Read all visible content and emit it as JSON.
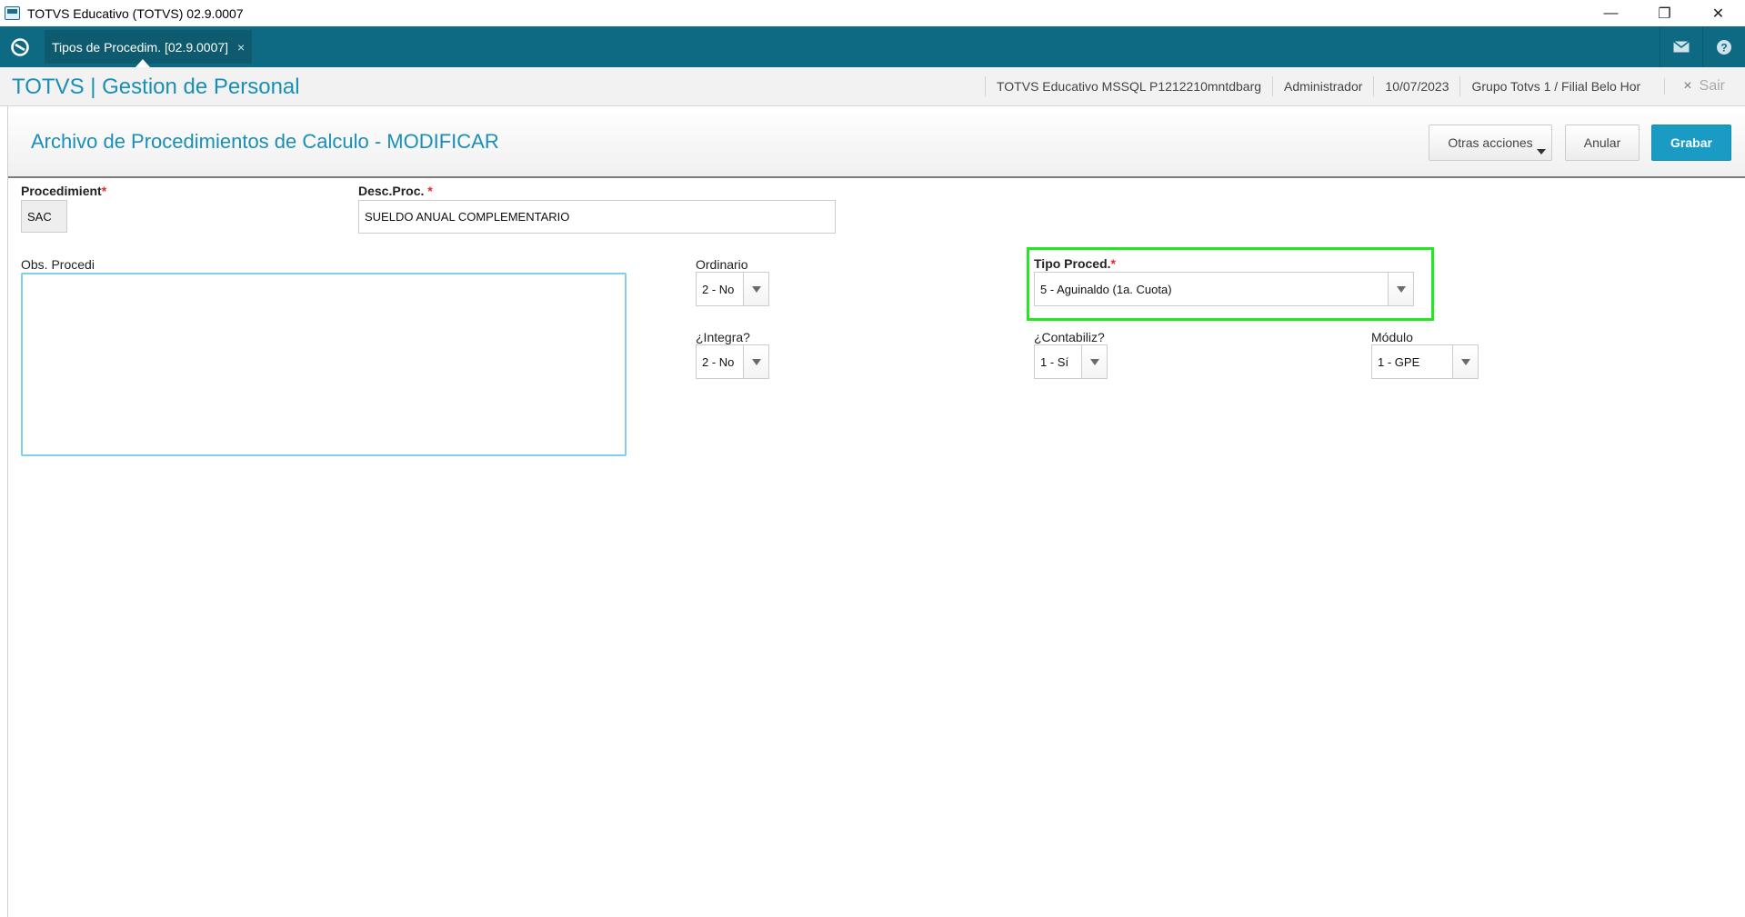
{
  "window": {
    "title": "TOTVS Educativo (TOTVS) 02.9.0007",
    "controls": {
      "minimize": "—",
      "restore": "❐",
      "close": "✕"
    }
  },
  "tabbar": {
    "tab_label": "Tipos de Procedim. [02.9.0007]",
    "tab_close": "×",
    "icons": [
      "home-icon",
      "mail-icon",
      "help-icon"
    ],
    "help_label": "?"
  },
  "header": {
    "app_title": "TOTVS | Gestion de Personal",
    "environment": "TOTVS Educativo MSSQL P1212210mntdbarg",
    "user": "Administrador",
    "date": "10/07/2023",
    "branch": "Grupo Totvs 1 / Filial Belo Hor",
    "exit_label": "Sair",
    "exit_icon": "×"
  },
  "form": {
    "title": "Archivo de Procedimientos de Calculo - MODIFICAR",
    "buttons": {
      "more": "Otras acciones",
      "cancel": "Anular",
      "save": "Grabar"
    },
    "fields": {
      "procedimiento": {
        "label": "Procedimient",
        "required": "*",
        "value": "SAC"
      },
      "desc_proc": {
        "label": "Desc.Proc.",
        "required": "*",
        "value": "SUELDO ANUAL COMPLEMENTARIO"
      },
      "obs": {
        "label": "Obs. Procedi",
        "value": ""
      },
      "ordinario": {
        "label": "Ordinario",
        "value": "2 - No"
      },
      "tipo_proced": {
        "label": "Tipo Proced.",
        "required": "*",
        "value": "5 - Aguinaldo (1a. Cuota)"
      },
      "integra": {
        "label": "¿Integra?",
        "value": "2 - No"
      },
      "contabiliz": {
        "label": "¿Contabiliz?",
        "value": "1 - Sí"
      },
      "modulo": {
        "label": "Módulo",
        "value": "1 - GPE"
      }
    }
  },
  "colors": {
    "teal_bar": "#0e6a82",
    "accent": "#1a8fb5",
    "save_button": "#1a9bc4",
    "highlight": "#22e822"
  }
}
